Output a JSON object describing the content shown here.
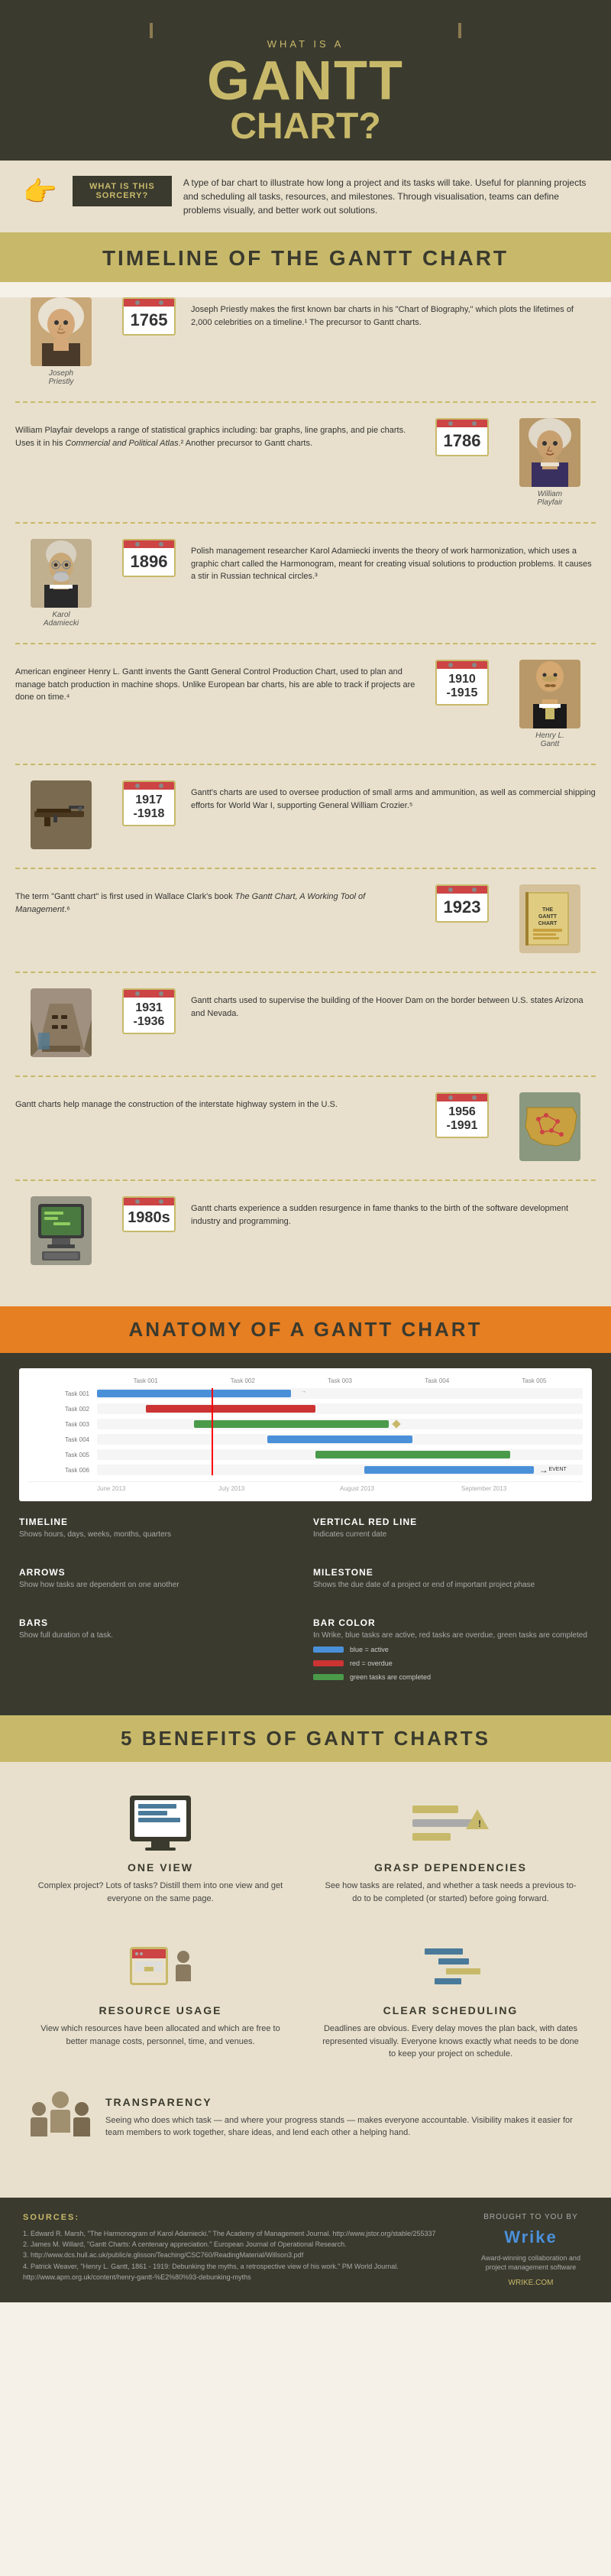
{
  "header": {
    "top_line": "What is a",
    "title": "Gantt",
    "title2": "Chart?",
    "question_mark": "?",
    "subtitle": "Gantt Chart?"
  },
  "sorcery": {
    "label": "What is this\nSorcery?",
    "text": "A type of bar chart to illustrate how long a project and its tasks will take. Useful for planning projects and scheduling all tasks, resources, and milestones. Through visualisation, teams can define problems visually, and better work out solutions."
  },
  "timeline": {
    "title": "Timeline of the Gantt Chart",
    "events": [
      {
        "year": "1765",
        "person_name": "Joseph Priestly",
        "side": "left",
        "text": "Joseph Priestly makes the first known bar charts in his \"Chart of Biography,\" which plots the lifetimes of 2,000 celebrities on a timeline.¹ The precursor to Gantt charts.",
        "has_portrait": true
      },
      {
        "year": "1786",
        "person_name": "William Playfair",
        "side": "right",
        "text": "William Playfair develops a range of statistical graphics including: bar graphs, line graphs, and pie charts. Uses it in his Commercial and Political Atlas.² Another precursor to Gantt charts.",
        "has_portrait": true
      },
      {
        "year": "1896",
        "person_name": "Karol Adamiecki",
        "side": "left",
        "text": "Polish management researcher Karol Adamiecki invents the theory of work harmonization, which uses a graphic chart called the Harmonogram, meant for creating visual solutions to production problems. It causes a stir in Russian technical circles.³",
        "has_portrait": true
      },
      {
        "year": "1910\n-1915",
        "person_name": "Henry L. Gantt",
        "side": "right",
        "text": "American engineer Henry L. Gantt invents the Gantt General Control Production Chart, used to plan and manage batch production in machine shops. Unlike European bar charts, his are able to track if projects are done on time.⁴",
        "has_portrait": true,
        "date_range": true
      },
      {
        "year": "1917\n-1918",
        "side": "left",
        "text": "Gantt's charts are used to oversee production of small arms and ammunition, as well as commercial shipping efforts for World War I, supporting General William Crozier.⁵",
        "has_portrait": false,
        "date_range": true,
        "image_type": "gun"
      },
      {
        "year": "1923",
        "side": "right",
        "text": "The term \"Gantt chart\" is first used in Wallace Clark's book The Gantt Chart, A Working Tool of Management.⁶",
        "has_portrait": false,
        "image_type": "book"
      },
      {
        "year": "1931\n-1936",
        "side": "left",
        "text": "Gantt charts used to supervise the building of the Hoover Dam on the border between U.S. states Arizona and Nevada.",
        "has_portrait": false,
        "image_type": "dam",
        "date_range": true
      },
      {
        "year": "1956\n-1991",
        "side": "right",
        "text": "Gantt charts help manage the construction of the interstate highway system in the U.S.",
        "has_portrait": false,
        "image_type": "highway",
        "date_range": true
      },
      {
        "year": "1980s",
        "side": "left",
        "text": "Gantt charts experience a sudden resurgence in fame thanks to the birth of the software development industry and programming.",
        "has_portrait": false,
        "image_type": "computer"
      }
    ]
  },
  "anatomy": {
    "title": "Anatomy of a Gantt Chart",
    "labels": {
      "timeline": {
        "title": "Timeline",
        "desc": "Shows hours, days, weeks, months, quarters"
      },
      "vertical_red_line": {
        "title": "Vertical Red Line",
        "desc": "Indicates current date"
      },
      "arrows": {
        "title": "Arrows",
        "desc": "Show how tasks are dependent on one another"
      },
      "milestone": {
        "title": "Milestone",
        "desc": "Shows the due date of a project or end of important project phase"
      },
      "bars": {
        "title": "Bars",
        "desc": "Show full duration of a task."
      },
      "bar_color": {
        "title": "Bar Color",
        "desc": "In Wrike, blue tasks are active, red tasks are overdue, green tasks are completed"
      }
    },
    "chart_tasks": [
      {
        "label": "Task 001",
        "start": 0,
        "width": 40,
        "color": "blue"
      },
      {
        "label": "Task 002",
        "start": 10,
        "width": 35,
        "color": "red"
      },
      {
        "label": "Task 003",
        "start": 20,
        "width": 45,
        "color": "green"
      },
      {
        "label": "Task 004",
        "start": 35,
        "width": 30,
        "color": "blue"
      },
      {
        "label": "Task 005",
        "start": 45,
        "width": 40,
        "color": "green"
      },
      {
        "label": "Task 006",
        "start": 50,
        "width": 35,
        "color": "blue"
      }
    ]
  },
  "benefits": {
    "title": "5 Benefits of Gantt Charts",
    "items": [
      {
        "id": "one-view",
        "title": "One View",
        "desc": "Complex project? Lots of tasks? Distill them into one view and get everyone on the same page.",
        "icon": "monitor"
      },
      {
        "id": "grasp-dependencies",
        "title": "Grasp Dependencies",
        "desc": "See how tasks are related, and whether a task needs a previous to-do to be completed (or started) before going forward.",
        "icon": "warning"
      },
      {
        "id": "resource-usage",
        "title": "Resource Usage",
        "desc": "View which resources have been allocated and which are free to better manage costs, personnel, time, and venues.",
        "icon": "calendar"
      },
      {
        "id": "clear-scheduling",
        "title": "Clear Scheduling",
        "desc": "Deadlines are obvious. Every delay moves the plan back, with dates represented visually. Everyone knows exactly what needs to be done to keep your project on schedule.",
        "icon": "bars"
      },
      {
        "id": "transparency",
        "title": "Transparency",
        "desc": "Seeing who does which task — and where your progress stands — makes everyone accountable. Visibility makes it easier for team members to work together, share ideas, and lend each other a helping hand.",
        "icon": "people"
      }
    ]
  },
  "sources": {
    "title": "Sources:",
    "items": [
      "1. Edward R. Marsh, \"The Harmonogram of Karol Adamiecki.\" The Academy of Management Journal. http://www.jstor.org/stable/255337",
      "2. James M. Willard, \"Gantt Charts: A centenary appreciation.\" European Journal of Operational Research.",
      "3. http://www.dcs.hull.ac.uk/public/e.glisson/Teaching/CSC760/ReadingMaterial/Willson3.pdf",
      "4. Patrick Weaver, \"Henry L. Gantt, 1861 - 1919: Debunking the myths, a retrospective view of his work.\" PM World Journal. http://www.apm.org.uk/content/henry-gantt-%E2%80%93-debunking-myths"
    ]
  },
  "footer": {
    "brought_by": "Brought to you by",
    "brand": "Wrike",
    "tagline": "Award-winning collaboration and project management software",
    "url": "WRIKE.COM"
  }
}
